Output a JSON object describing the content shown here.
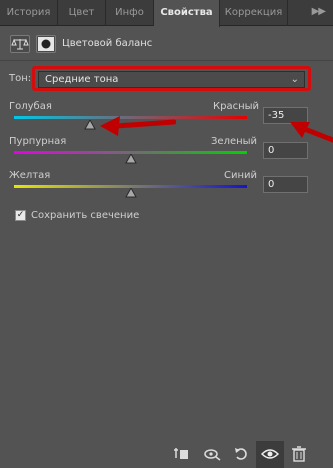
{
  "tabs": [
    {
      "label": "История"
    },
    {
      "label": "Цвет"
    },
    {
      "label": "Инфо"
    },
    {
      "label": "Свойства"
    },
    {
      "label": "Коррекция"
    }
  ],
  "header": {
    "title": "Цветовой баланс"
  },
  "tone": {
    "label": "Тон:",
    "value": "Средние тона"
  },
  "sliders": [
    {
      "left_label": "Голубая",
      "right_label": "Красный",
      "value": "-35",
      "position": -35
    },
    {
      "left_label": "Пурпурная",
      "right_label": "Зеленый",
      "value": "0",
      "position": 0
    },
    {
      "left_label": "Желтая",
      "right_label": "Синий",
      "value": "0",
      "position": 0
    }
  ],
  "preserve_luminosity": {
    "label": "Сохранить свечение",
    "checked": true
  },
  "colors": {
    "accent_red": "#d40c0c"
  },
  "bottom_icons": [
    "clip-to-layer-icon",
    "view-previous-icon",
    "reset-icon",
    "visibility-eye-icon",
    "trash-icon"
  ]
}
